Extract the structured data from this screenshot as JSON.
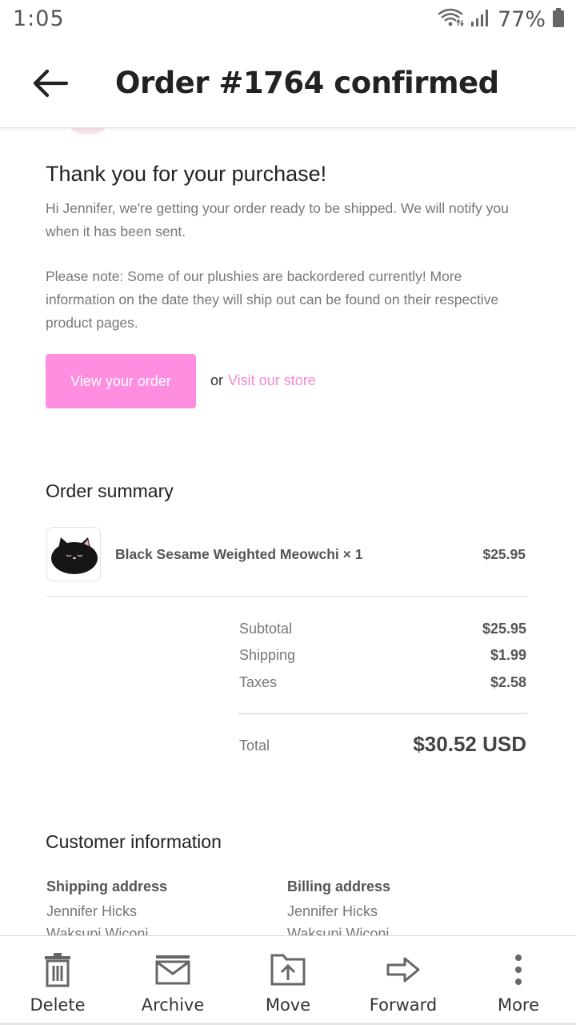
{
  "status_bar": {
    "time": "1:05",
    "battery": "77%"
  },
  "app_bar": {
    "title": "Order #1764 confirmed"
  },
  "email": {
    "greeting": "Thank you for your purchase!",
    "paragraph_1": "Hi Jennifer, we're getting your order ready to be shipped. We will notify you when it has been sent.",
    "paragraph_2": "Please note: Some of our plushies are backordered currently! More information on the date they will ship out can be found on their respective product pages.",
    "view_order_button": "View your order",
    "or_text": "or",
    "store_link": "Visit our store"
  },
  "order_summary": {
    "title": "Order summary",
    "item": {
      "name": "Black Sesame Weighted Meowchi × 1",
      "price": "$25.95"
    },
    "subtotal": {
      "label": "Subtotal",
      "value": "$25.95"
    },
    "shipping": {
      "label": "Shipping",
      "value": "$1.99"
    },
    "taxes": {
      "label": "Taxes",
      "value": "$2.58"
    },
    "total": {
      "label": "Total",
      "value": "$30.52 USD"
    }
  },
  "customer_info": {
    "title": "Customer information",
    "shipping_address": {
      "heading": "Shipping address",
      "name": "Jennifer Hicks",
      "line_2": "Waksupi Wiconi"
    },
    "billing_address": {
      "heading": "Billing address",
      "name": "Jennifer Hicks",
      "line_2": "Waksupi Wiconi"
    }
  },
  "bottom_actions": {
    "delete": "Delete",
    "archive": "Archive",
    "move": "Move",
    "forward": "Forward",
    "more": "More"
  },
  "colors": {
    "accent_pink": "#ff8ee0",
    "link_pink": "#f58ad6",
    "text_dark": "#222222",
    "text_muted": "#777777"
  },
  "icons": [
    "wifi-icon",
    "signal-icon",
    "battery-icon",
    "back-arrow-icon",
    "trash-icon",
    "archive-icon",
    "move-icon",
    "forward-icon",
    "more-vertical-icon"
  ]
}
